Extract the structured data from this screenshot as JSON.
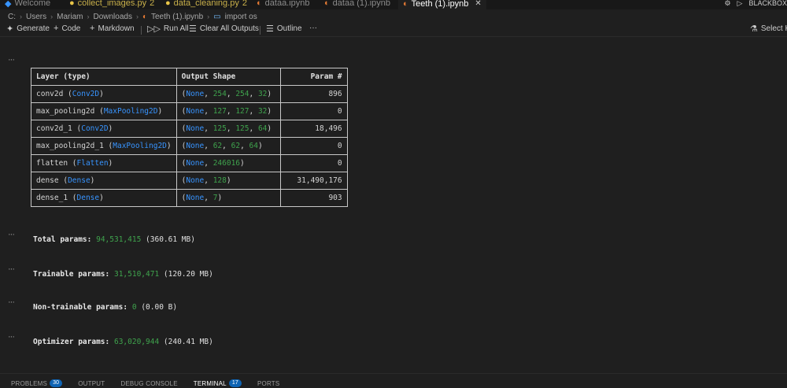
{
  "tabs": [
    {
      "label": "Welcome",
      "icon": "vscode-logo-icon",
      "modified": false,
      "active": false
    },
    {
      "label": "collect_images.py",
      "suffix": "2",
      "icon": "python-file-icon",
      "modified": true,
      "active": false
    },
    {
      "label": "data_cleaning.py",
      "suffix": "2",
      "icon": "python-file-icon",
      "modified": true,
      "active": false
    },
    {
      "label": "dataa.ipynb",
      "icon": "jupyter-file-icon",
      "modified": false,
      "active": false
    },
    {
      "label": "dataa (1).ipynb",
      "icon": "jupyter-file-icon",
      "modified": false,
      "active": false
    },
    {
      "label": "Teeth (1).ipynb",
      "icon": "jupyter-file-icon",
      "modified": false,
      "active": true
    }
  ],
  "topright": {
    "kernel": "BLACKBOX"
  },
  "breadcrumb": {
    "parts": [
      "C:",
      "Users",
      "Mariam",
      "Downloads",
      "Teeth (1).ipynb",
      "import os"
    ]
  },
  "toolbar": {
    "generate": "Generate",
    "code": "Code",
    "markdown": "Markdown",
    "run_all": "Run All",
    "clear_all": "Clear All Outputs",
    "outline": "Outline",
    "more": "···",
    "select_kernel": "Select Ke"
  },
  "ellipsis": "···",
  "model_table": {
    "headers": [
      "Layer (type)",
      "Output Shape",
      "Param #"
    ],
    "rows": [
      {
        "name": "conv2d",
        "type": "Conv2D",
        "shape": [
          "254",
          "254",
          "32"
        ],
        "params": "896"
      },
      {
        "name": "max_pooling2d",
        "type": "MaxPooling2D",
        "shape": [
          "127",
          "127",
          "32"
        ],
        "params": "0"
      },
      {
        "name": "conv2d_1",
        "type": "Conv2D",
        "shape": [
          "125",
          "125",
          "64"
        ],
        "params": "18,496"
      },
      {
        "name": "max_pooling2d_1",
        "type": "MaxPooling2D",
        "shape": [
          "62",
          "62",
          "64"
        ],
        "params": "0"
      },
      {
        "name": "flatten",
        "type": "Flatten",
        "shape": [
          "246016"
        ],
        "params": "0"
      },
      {
        "name": "dense",
        "type": "Dense",
        "shape": [
          "128"
        ],
        "params": "31,490,176"
      },
      {
        "name": "dense_1",
        "type": "Dense",
        "shape": [
          "7"
        ],
        "params": "903"
      }
    ],
    "none_word": "None"
  },
  "summary": {
    "total": {
      "label": "Total params:",
      "value": "94,531,415",
      "size": "(360.61 MB)"
    },
    "trainable": {
      "label": "Trainable params:",
      "value": "31,510,471",
      "size": "(120.20 MB)"
    },
    "non_trainable": {
      "label": "Non-trainable params:",
      "value": "0",
      "size": "(0.00 B)"
    },
    "optimizer": {
      "label": "Optimizer params:",
      "value": "63,020,944",
      "size": "(240.41 MB)"
    }
  },
  "panel": {
    "problems": "PROBLEMS",
    "problems_count": "30",
    "output": "OUTPUT",
    "debug": "DEBUG CONSOLE",
    "terminal": "TERMINAL",
    "terminal_count": "17",
    "ports": "PORTS"
  },
  "colors": {
    "accent": "#0078d4",
    "number": "#3fa34d",
    "keyword": "#3794ff",
    "badge": "#0e64b4"
  }
}
